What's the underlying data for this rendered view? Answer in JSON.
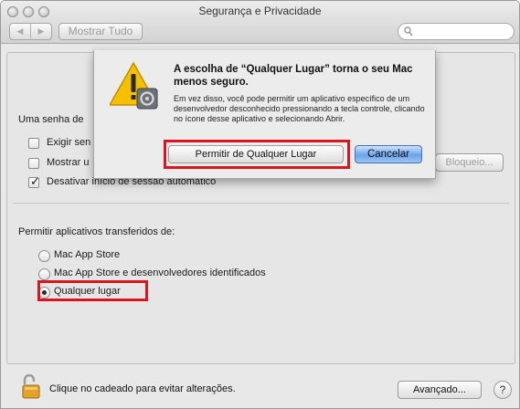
{
  "window": {
    "title": "Segurança e Privacidade",
    "show_all": "Mostrar Tudo",
    "nav_back": "◀",
    "nav_forward": "▶"
  },
  "panel": {
    "password_section_label": "Uma senha de",
    "require_password_label": "Exigir sen",
    "show_message_label": "Mostrar u",
    "disable_autologin_label": "Desativar início de sessão automático",
    "lock_message_button": "Bloqueio...",
    "allow_apps_label": "Permitir aplicativos transferidos de:",
    "radio_options": [
      {
        "label": "Mac App Store",
        "selected": false
      },
      {
        "label": "Mac App Store e desenvolvedores identificados",
        "selected": false
      },
      {
        "label": "Qualquer lugar",
        "selected": true
      }
    ]
  },
  "footer": {
    "lock_text": "Clique no cadeado para evitar alterações.",
    "advanced_button": "Avançado...",
    "help_button": "?"
  },
  "sheet": {
    "heading": "A escolha de “Qualquer Lugar” torna o seu Mac menos seguro.",
    "body": "Em vez disso, você pode permitir um aplicativo específico de um desenvolvedor desconhecido pressionando a tecla controle, clicando no ícone desse aplicativo e selecionando Abrir.",
    "allow_button": "Permitir de Qualquer Lugar",
    "cancel_button": "Cancelar"
  },
  "colors": {
    "highlight": "#d9151d",
    "default_button": "#6aa3ea",
    "warning": "#f6c000"
  }
}
